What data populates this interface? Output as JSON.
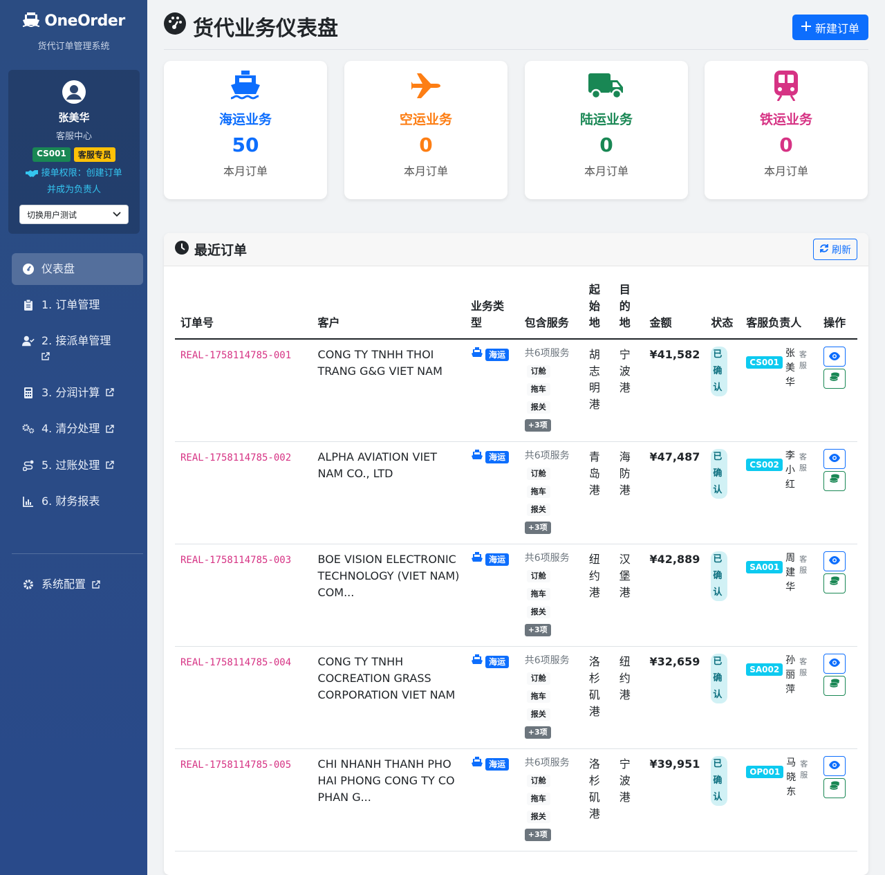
{
  "brand": {
    "title": "OneOrder",
    "subtitle": "货代订单管理系统"
  },
  "user": {
    "name": "张美华",
    "dept": "客服中心",
    "code": "CS001",
    "role": "客服专员",
    "permission_line1": "接单权限：创建订单",
    "permission_line2": "并成为负责人",
    "switch_label": "切换用户测试"
  },
  "nav": {
    "dashboard": "仪表盘",
    "order_mgmt": "1. 订单管理",
    "dispatch_mgmt": "2. 接派单管理",
    "profit_calc": "3. 分润计算",
    "clearing": "4. 清分处理",
    "posting": "5. 过账处理",
    "reports": "6. 财务报表",
    "config": "系统配置"
  },
  "header": {
    "title": "货代业务仪表盘",
    "new_order": "新建订单"
  },
  "stats": [
    {
      "title": "海运业务",
      "value": "50",
      "label": "本月订单",
      "color": "#0d6efd",
      "icon": "ship-icon"
    },
    {
      "title": "空运业务",
      "value": "0",
      "label": "本月订单",
      "color": "#fd7e14",
      "icon": "plane-icon"
    },
    {
      "title": "陆运业务",
      "value": "0",
      "label": "本月订单",
      "color": "#198754",
      "icon": "truck-icon"
    },
    {
      "title": "铁运业务",
      "value": "0",
      "label": "本月订单",
      "color": "#d63384",
      "icon": "train-icon"
    }
  ],
  "orders": {
    "title": "最近订单",
    "refresh": "刷新",
    "columns": {
      "order_no": "订单号",
      "customer": "客户",
      "type": "业务类型",
      "services": "包含服务",
      "origin": "起始地",
      "dest": "目的地",
      "amount": "金额",
      "status": "状态",
      "owner": "客服负责人",
      "actions": "操作"
    },
    "rows": [
      {
        "order_no": "REAL-1758114785-001",
        "customer": "CONG TY TNHH THOI TRANG G&G VIET NAM",
        "type": "海运",
        "svc_count": "共6项服务",
        "svc": [
          "订舱",
          "拖车",
          "报关"
        ],
        "more": "+3项",
        "origin": "胡志明港",
        "dest": "宁波港",
        "amount": "¥41,582",
        "status": "已确认",
        "owner_code": "CS001",
        "owner_name": "张美华",
        "owner_role": "客服"
      },
      {
        "order_no": "REAL-1758114785-002",
        "customer": "ALPHA AVIATION VIET NAM CO., LTD",
        "type": "海运",
        "svc_count": "共6项服务",
        "svc": [
          "订舱",
          "拖车",
          "报关"
        ],
        "more": "+3项",
        "origin": "青岛港",
        "dest": "海防港",
        "amount": "¥47,487",
        "status": "已确认",
        "owner_code": "CS002",
        "owner_name": "李小红",
        "owner_role": "客服"
      },
      {
        "order_no": "REAL-1758114785-003",
        "customer": "BOE VISION ELECTRONIC TECHNOLOGY (VIET NAM) COM...",
        "type": "海运",
        "svc_count": "共6项服务",
        "svc": [
          "订舱",
          "拖车",
          "报关"
        ],
        "more": "+3项",
        "origin": "纽约港",
        "dest": "汉堡港",
        "amount": "¥42,889",
        "status": "已确认",
        "owner_code": "SA001",
        "owner_name": "周建华",
        "owner_role": "客服"
      },
      {
        "order_no": "REAL-1758114785-004",
        "customer": "CONG TY TNHH COCREATION GRASS CORPORATION VIET NAM",
        "type": "海运",
        "svc_count": "共6项服务",
        "svc": [
          "订舱",
          "拖车",
          "报关"
        ],
        "more": "+3项",
        "origin": "洛杉矶港",
        "dest": "纽约港",
        "amount": "¥32,659",
        "status": "已确认",
        "owner_code": "SA002",
        "owner_name": "孙丽萍",
        "owner_role": "客服"
      },
      {
        "order_no": "REAL-1758114785-005",
        "customer": "CHI NHANH THANH PHO HAI PHONG CONG TY CO PHAN G...",
        "type": "海运",
        "svc_count": "共6项服务",
        "svc": [
          "订舱",
          "拖车",
          "报关"
        ],
        "more": "+3项",
        "origin": "洛杉矶港",
        "dest": "宁波港",
        "amount": "¥39,951",
        "status": "已确认",
        "owner_code": "OP001",
        "owner_name": "马晓东",
        "owner_role": "客服"
      }
    ]
  }
}
